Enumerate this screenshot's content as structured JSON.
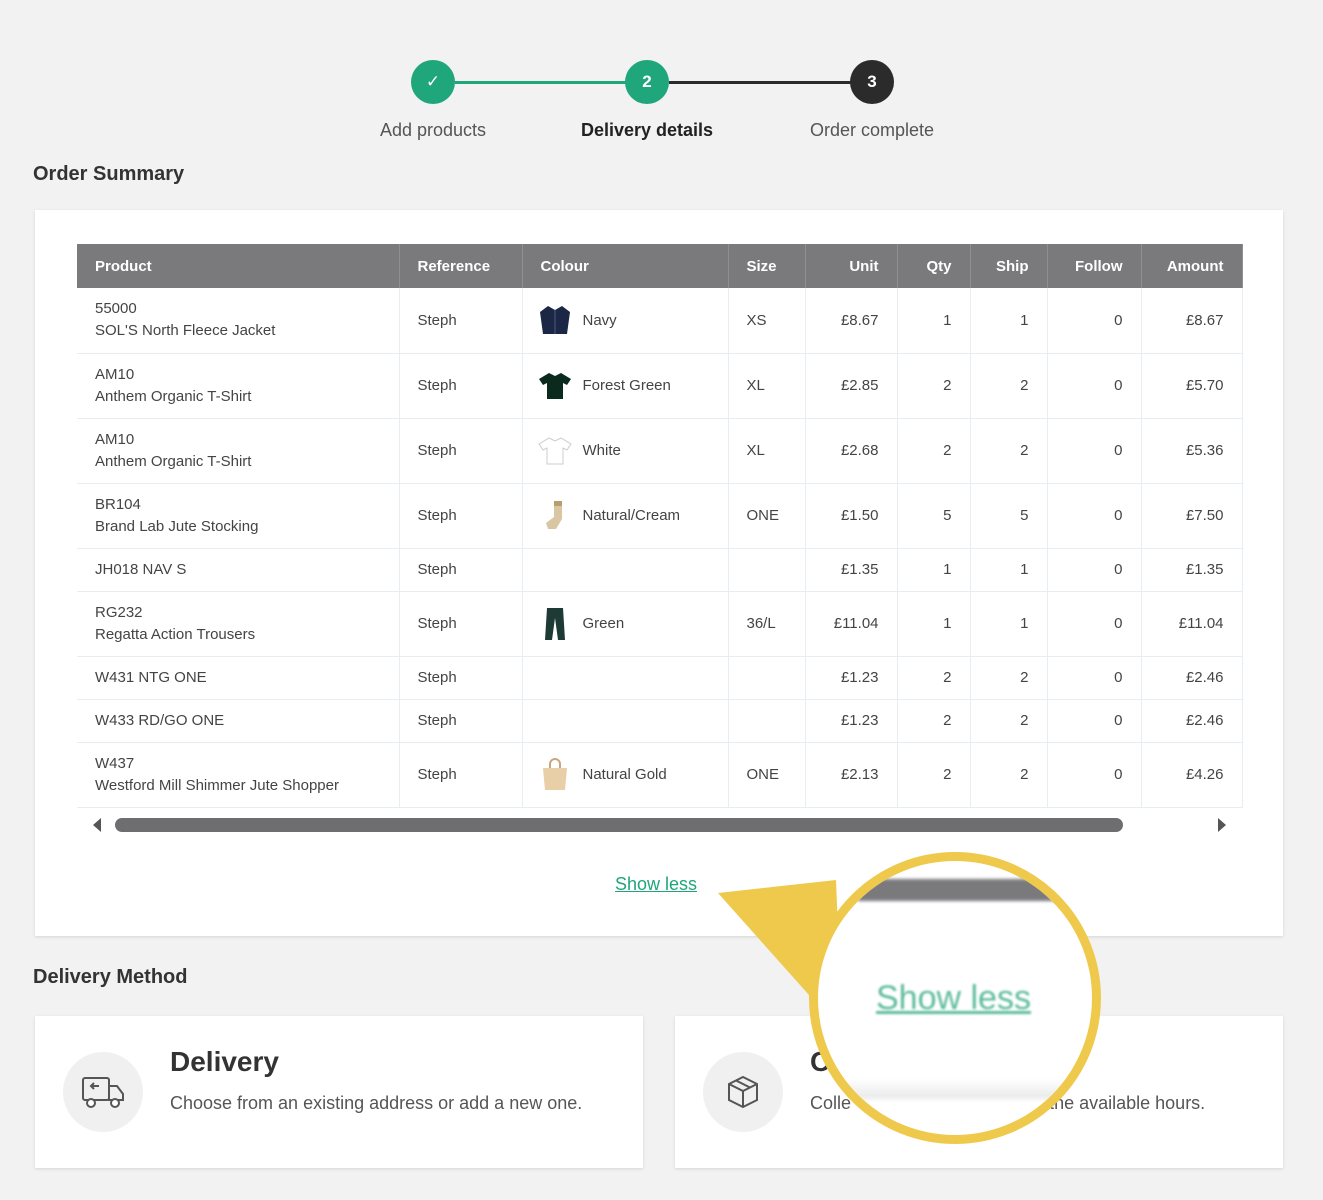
{
  "stepper": {
    "steps": [
      {
        "label": "Add products",
        "marker": "✓",
        "state": "complete"
      },
      {
        "label": "Delivery details",
        "marker": "2",
        "state": "active"
      },
      {
        "label": "Order complete",
        "marker": "3",
        "state": "upcoming"
      }
    ]
  },
  "order_summary": {
    "heading": "Order Summary",
    "columns": [
      "Product",
      "Reference",
      "Colour",
      "Size",
      "Unit",
      "Qty",
      "Ship",
      "Follow",
      "Amount"
    ],
    "rows": [
      {
        "code": "55000",
        "name": "SOL'S North Fleece Jacket",
        "reference": "Steph",
        "colour": "Navy",
        "icon": "jacket-icon",
        "size": "XS",
        "unit": "£8.67",
        "qty": "1",
        "ship": "1",
        "follow": "0",
        "amount": "£8.67"
      },
      {
        "code": "AM10",
        "name": "Anthem Organic T-Shirt",
        "reference": "Steph",
        "colour": "Forest Green",
        "icon": "tshirt-icon",
        "size": "XL",
        "unit": "£2.85",
        "qty": "2",
        "ship": "2",
        "follow": "0",
        "amount": "£5.70"
      },
      {
        "code": "AM10",
        "name": "Anthem Organic T-Shirt",
        "reference": "Steph",
        "colour": "White",
        "icon": "tshirt-icon",
        "size": "XL",
        "unit": "£2.68",
        "qty": "2",
        "ship": "2",
        "follow": "0",
        "amount": "£5.36"
      },
      {
        "code": "BR104",
        "name": "Brand Lab Jute Stocking",
        "reference": "Steph",
        "colour": "Natural/Cream",
        "icon": "stocking-icon",
        "size": "ONE",
        "unit": "£1.50",
        "qty": "5",
        "ship": "5",
        "follow": "0",
        "amount": "£7.50"
      },
      {
        "code": "JH018 NAV S",
        "name": "",
        "reference": "Steph",
        "colour": "",
        "icon": "",
        "size": "",
        "unit": "£1.35",
        "qty": "1",
        "ship": "1",
        "follow": "0",
        "amount": "£1.35"
      },
      {
        "code": "RG232",
        "name": "Regatta Action Trousers",
        "reference": "Steph",
        "colour": "Green",
        "icon": "trousers-icon",
        "size": "36/L",
        "unit": "£11.04",
        "qty": "1",
        "ship": "1",
        "follow": "0",
        "amount": "£11.04"
      },
      {
        "code": "W431 NTG ONE",
        "name": "",
        "reference": "Steph",
        "colour": "",
        "icon": "",
        "size": "",
        "unit": "£1.23",
        "qty": "2",
        "ship": "2",
        "follow": "0",
        "amount": "£2.46"
      },
      {
        "code": "W433 RD/GO ONE",
        "name": "",
        "reference": "Steph",
        "colour": "",
        "icon": "",
        "size": "",
        "unit": "£1.23",
        "qty": "2",
        "ship": "2",
        "follow": "0",
        "amount": "£2.46"
      },
      {
        "code": "W437",
        "name": "Westford Mill Shimmer Jute Shopper",
        "reference": "Steph",
        "colour": "Natural Gold",
        "icon": "bag-icon",
        "size": "ONE",
        "unit": "£2.13",
        "qty": "2",
        "ship": "2",
        "follow": "0",
        "amount": "£4.26"
      }
    ],
    "show_less": "Show less"
  },
  "delivery_method": {
    "heading": "Delivery Method",
    "options": [
      {
        "title": "Delivery",
        "description": "Choose from an existing address or add a new one.",
        "icon": "truck-icon"
      },
      {
        "title": "C",
        "description": "Colle                              ween the available hours.",
        "icon": "package-icon"
      }
    ]
  },
  "callout": {
    "text": "Show less"
  },
  "colors": {
    "accent": "#1fa67a",
    "dark": "#2b2b2b",
    "header": "#7a7a7c",
    "callout_ring": "#efc94c"
  }
}
